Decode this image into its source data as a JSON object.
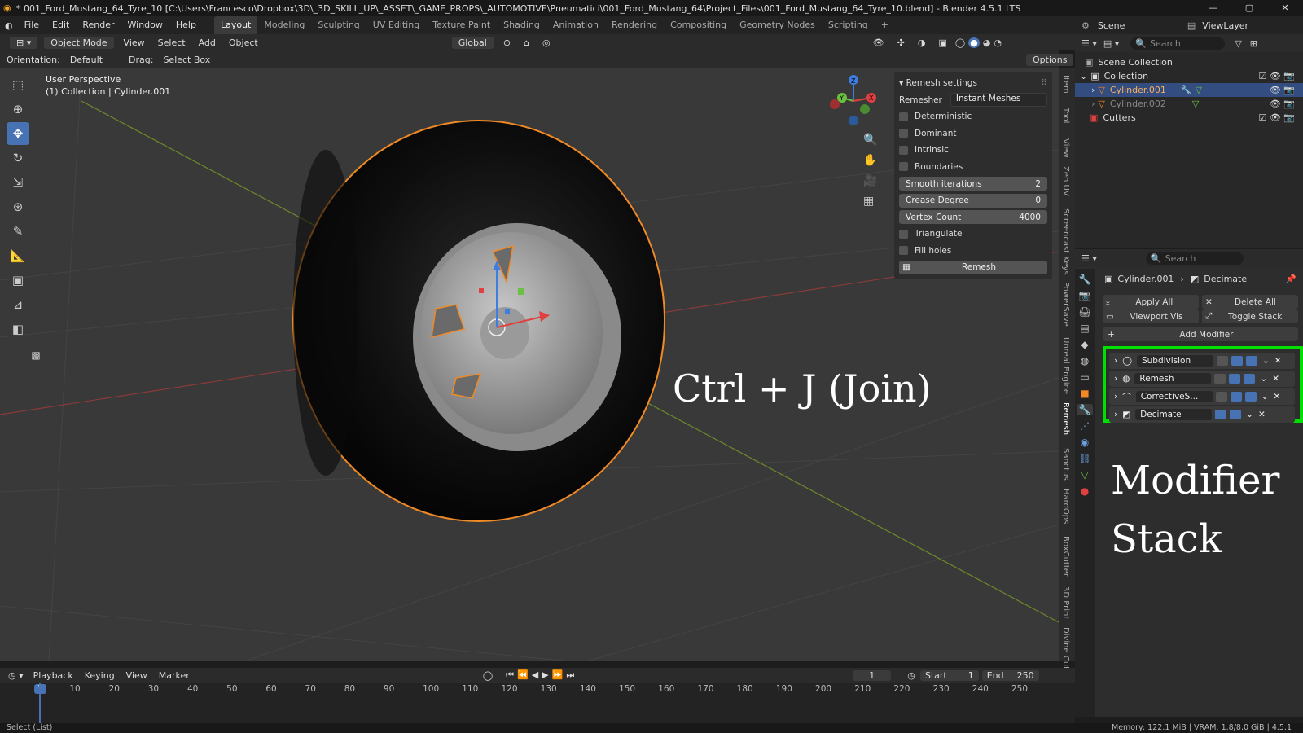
{
  "window": {
    "title": "* 001_Ford_Mustang_64_Tyre_10 [C:\\Users\\Francesco\\Dropbox\\3D\\_3D_SKILL_UP\\_ASSET\\_GAME_PROPS\\_AUTOMOTIVE\\Pneumatici\\001_Ford_Mustang_64\\Project_Files\\001_Ford_Mustang_64_Tyre_10.blend] - Blender 4.5.1 LTS"
  },
  "menu": {
    "items": [
      "File",
      "Edit",
      "Render",
      "Window",
      "Help"
    ],
    "workspaces": [
      "Layout",
      "Modeling",
      "Sculpting",
      "UV Editing",
      "Texture Paint",
      "Shading",
      "Animation",
      "Rendering",
      "Compositing",
      "Geometry Nodes",
      "Scripting"
    ],
    "scene": "Scene",
    "view_layer": "ViewLayer"
  },
  "viewport_header": {
    "mode": "Object Mode",
    "menus": [
      "View",
      "Select",
      "Add",
      "Object"
    ],
    "transform": "Global",
    "orientation_label": "Orientation:",
    "orientation_value": "Default",
    "drag_label": "Drag:",
    "drag_value": "Select Box",
    "options": "Options"
  },
  "viewport": {
    "perspective": "User Perspective",
    "collection_info": "(1) Collection | Cylinder.001",
    "overlay_text_1": "Ctrl + J (Join)",
    "overlay_text_2": "Modifier",
    "overlay_text_3": "Stack"
  },
  "remesh_panel": {
    "title": "Remesh settings",
    "remesher_label": "Remesher",
    "remesher_value": "Instant Meshes",
    "checkboxes": [
      "Deterministic",
      "Dominant",
      "Intrinsic",
      "Boundaries"
    ],
    "fields": [
      {
        "label": "Smooth iterations",
        "value": "2"
      },
      {
        "label": "Crease Degree",
        "value": "0"
      },
      {
        "label": "Vertex Count",
        "value": "4000"
      }
    ],
    "checkboxes2": [
      "Triangulate",
      "Fill holes"
    ],
    "button": "Remesh"
  },
  "side_tabs": [
    "Item",
    "Tool",
    "View",
    "Zen UV",
    "Screencast Keys",
    "PowerSave",
    "Unreal Engine",
    "Remesh",
    "Sanctus",
    "HardOps",
    "BoxCutter",
    "3D Print",
    "Divine Cut"
  ],
  "outliner": {
    "search_placeholder": "Search",
    "items": [
      {
        "label": "Scene Collection"
      },
      {
        "label": "Collection"
      },
      {
        "label": "Cylinder.001"
      },
      {
        "label": "Cylinder.002"
      },
      {
        "label": "Cutters"
      }
    ]
  },
  "properties": {
    "search_placeholder": "Search",
    "object": "Cylinder.001",
    "modifier_crumb": "Decimate",
    "apply_all": "Apply All",
    "delete_all": "Delete All",
    "viewport_vis": "Viewport Vis",
    "toggle_stack": "Toggle Stack",
    "add_modifier": "Add Modifier",
    "modifiers": [
      "Subdivision",
      "Remesh",
      "CorrectiveS...",
      "Decimate"
    ]
  },
  "timeline": {
    "menus": [
      "Playback",
      "Keying",
      "View",
      "Marker"
    ],
    "current_frame": "1",
    "start_label": "Start",
    "start": "1",
    "end_label": "End",
    "end": "250",
    "ticks": [
      "1",
      "10",
      "20",
      "30",
      "40",
      "50",
      "60",
      "70",
      "80",
      "90",
      "100",
      "110",
      "120",
      "130",
      "140",
      "150",
      "160",
      "170",
      "180",
      "190",
      "200",
      "210",
      "220",
      "230",
      "240",
      "250"
    ]
  },
  "status": {
    "left": "Select (List)",
    "right": "Memory: 122.1 MiB | VRAM: 1.8/8.0 GiB | 4.5.1"
  },
  "colors": {
    "accent": "#4772b3",
    "selection_outline": "#f08a24",
    "highlight_box": "#00e000"
  }
}
